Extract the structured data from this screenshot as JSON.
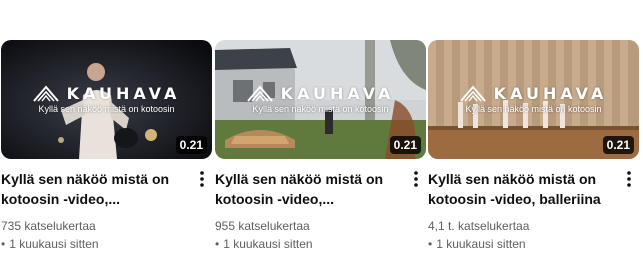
{
  "videos": [
    {
      "brand": "KAUHAVA",
      "tagline": "Kyllä sen näköö mistä on kotoosin",
      "duration": "0.21",
      "title": "Kyllä sen näköö mistä on kotoosin -video,...",
      "views": "735 katselukertaa",
      "age": "1 kuukausi sitten"
    },
    {
      "brand": "KAUHAVA",
      "tagline": "Kyllä sen näköö mistä on kotoosin",
      "duration": "0.21",
      "title": "Kyllä sen näköö mistä on kotoosin -video,...",
      "views": "955 katselukertaa",
      "age": "1 kuukausi sitten"
    },
    {
      "brand": "KAUHAVA",
      "tagline": "Kyllä sen näköö mistä on kotoosin",
      "duration": "0.21",
      "title": "Kyllä sen näköö mistä on kotoosin -video, balleriina",
      "views": "4,1 t. katselukertaa",
      "age": "1 kuukausi sitten"
    }
  ],
  "ui": {
    "separator": "•",
    "menu_icon": "more-vert-icon",
    "logo_icon": "kauhava-logo-icon"
  }
}
